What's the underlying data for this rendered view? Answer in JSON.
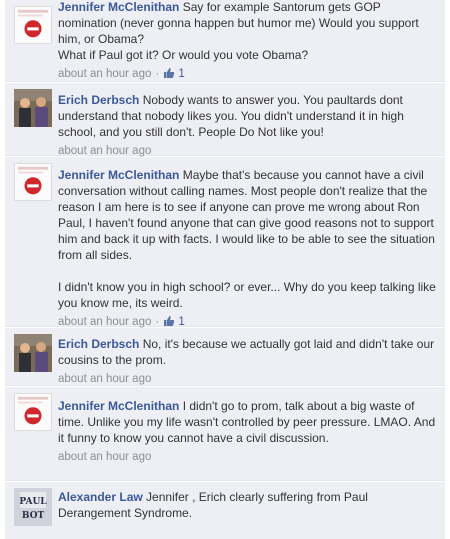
{
  "comments": [
    {
      "author": "Jennifer McClenithan",
      "avatar": "no-entry-sign",
      "paragraphs": [
        "Say for example Santorum gets GOP nomination (never gonna happen but humor me) Would you support him, or Obama?",
        "What if Paul got it? Or would you vote Obama?"
      ],
      "time": "about an hour ago",
      "likes": "1"
    },
    {
      "author": "Erich Derbsch",
      "avatar": "two-men-photo",
      "paragraphs": [
        "Nobody wants to answer you. You paultards dont understand that nobody likes you. You didn't understand it in high school, and you still don't. People Do Not like you!"
      ],
      "time": "about an hour ago",
      "likes": ""
    },
    {
      "author": "Jennifer McClenithan",
      "avatar": "no-entry-sign",
      "paragraphs": [
        "Maybe that's because you cannot have a civil conversation without calling names. Most people don't realize that the reason I am here is to see if anyone can prove me wrong about Ron Paul, I haven't found anyone that can give good reasons not to support him and back it up with facts. I would like to be able to see the situation from all sides.",
        "I didn't know you in high school? or ever... Why do you keep talking like you know me, its weird."
      ],
      "time": "about an hour ago",
      "likes": "1"
    },
    {
      "author": "Erich Derbsch",
      "avatar": "two-men-photo",
      "paragraphs": [
        "No, it's because we actually got laid and didn't take our cousins to the prom."
      ],
      "time": "about an hour ago",
      "likes": ""
    },
    {
      "author": "Jennifer McClenithan",
      "avatar": "no-entry-sign",
      "paragraphs": [
        "I didn't go to prom, talk about a big waste of time. Unlike you my life wasn't controlled by peer pressure. LMAO. And it funny to know you cannot have a civil discussion."
      ],
      "time": "about an hour ago",
      "likes": ""
    },
    {
      "author": "Alexander Law",
      "avatar": "paul-bot-image",
      "avatar_text": [
        "PAUL",
        "BOT"
      ],
      "paragraphs": [
        "Jennifer , Erich clearly suffering from Paul Derangement Syndrome."
      ],
      "time": "",
      "likes": ""
    }
  ],
  "labels": {
    "sep": "·"
  },
  "colors": {
    "author": "#3b5998",
    "background": "#edeff4",
    "meta": "#8a8f99"
  }
}
